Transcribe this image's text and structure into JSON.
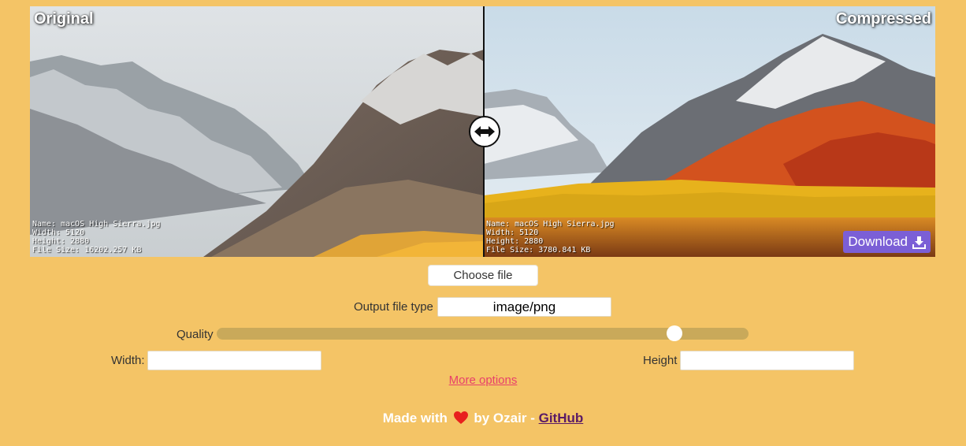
{
  "compare": {
    "left_label": "Original",
    "right_label": "Compressed",
    "original": {
      "name_line": "Name: macOS High Sierra.jpg",
      "width_line": "Width: 5120",
      "height_line": "Height: 2880",
      "size_line": "File Size: 16202.257 KB"
    },
    "compressed": {
      "name_line": "Name: macOS High Sierra.jpg",
      "width_line": "Width: 5120",
      "height_line": "Height: 2880",
      "size_line": "File Size: 3780.841 KB"
    },
    "download_label": "Download",
    "handle_icon": "left-right-arrow-icon"
  },
  "controls": {
    "choose_file_label": "Choose file",
    "output_type_label": "Output file type",
    "output_type_value": "image/png",
    "quality_label": "Quality",
    "quality_fraction": 0.86,
    "width_label": "Width:",
    "width_value": "",
    "height_label": "Height",
    "height_value": "",
    "more_options_label": "More options"
  },
  "footer": {
    "made_with": "Made with",
    "by_text": "by Ozair",
    "separator": "-",
    "github_label": "GitHub"
  },
  "colors": {
    "background": "#f4c466",
    "download_button": "#7b5fd6",
    "link": "#e8406a",
    "github_link": "#5a1a66"
  }
}
